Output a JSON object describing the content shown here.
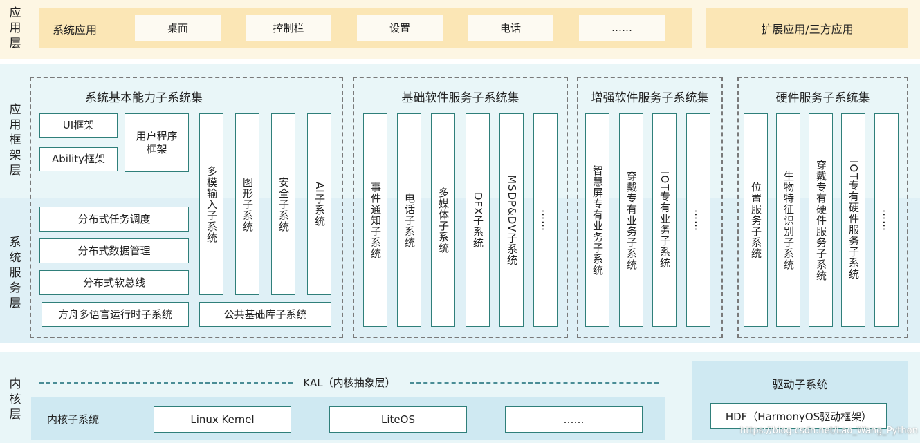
{
  "layers": {
    "app": "应用层",
    "framework": "应用框架层",
    "service": "系统服务层",
    "kernel": "内核层"
  },
  "app_layer": {
    "system_apps_label": "系统应用",
    "apps": [
      "桌面",
      "控制栏",
      "设置",
      "电话",
      "……"
    ],
    "ext_apps": "扩展应用/三方应用"
  },
  "groups": {
    "basic": {
      "title": "系统基本能力子系统集",
      "ui_framework": "UI框架",
      "ability_framework": "Ability框架",
      "user_program_framework": "用户程序框架",
      "vertical": [
        "多模输入子系统",
        "图形子系统",
        "安全子系统",
        "AI子系统"
      ],
      "distributed": [
        "分布式任务调度",
        "分布式数据管理",
        "分布式软总线"
      ],
      "ark_runtime": "方舟多语言运行时子系统",
      "common_lib": "公共基础库子系统"
    },
    "software": {
      "title": "基础软件服务子系统集",
      "items": [
        "事件通知子系统",
        "电话子系统",
        "多媒体子系统",
        "DFX子系统",
        "MSDP&DV子系统",
        "……"
      ]
    },
    "enhanced": {
      "title": "增强软件服务子系统集",
      "items": [
        "智慧屏专有业务子系统",
        "穿戴专有业务子系统",
        "IOT专有业务子系统",
        "……"
      ]
    },
    "hardware": {
      "title": "硬件服务子系统集",
      "items": [
        "位置服务子系统",
        "生物特征识别子系统",
        "穿戴专有硬件服务子系统",
        "IOT专有硬件服务子系统",
        "……"
      ]
    }
  },
  "kernel_layer": {
    "kal": "KAL（内核抽象层）",
    "kernel_subsystem_label": "内核子系统",
    "kernels": [
      "Linux Kernel",
      "LiteOS",
      "……"
    ],
    "driver_subsystem": "驱动子系统",
    "hdf": "HDF（HarmonyOS驱动框架）"
  },
  "watermark": "https://blog.csdn.net/Lao_Wang_Python"
}
